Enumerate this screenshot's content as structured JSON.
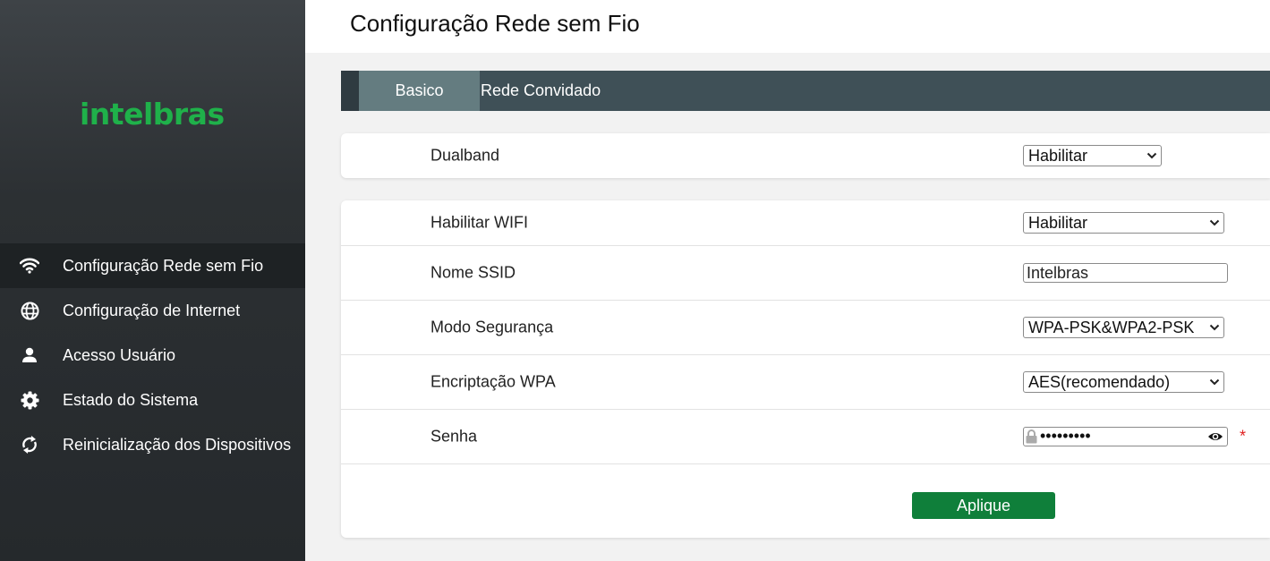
{
  "sidebar": {
    "logo": "intelbras",
    "items": [
      {
        "label": "Configuração Rede sem Fio",
        "icon": "wifi-icon",
        "active": true
      },
      {
        "label": "Configuração de Internet",
        "icon": "globe-icon",
        "active": false
      },
      {
        "label": "Acesso Usuário",
        "icon": "user-icon",
        "active": false
      },
      {
        "label": "Estado do Sistema",
        "icon": "gear-icon",
        "active": false
      },
      {
        "label": "Reinicialização dos Dispositivos",
        "icon": "refresh-icon",
        "active": false
      }
    ]
  },
  "header": {
    "title": "Configuração Rede sem Fio"
  },
  "tabs": [
    {
      "label": "Basico",
      "active": true
    },
    {
      "label": "Rede Convidado",
      "active": false
    }
  ],
  "dualband": {
    "label": "Dualband",
    "value": "Habilitar"
  },
  "form": {
    "wifi": {
      "label": "Habilitar WIFI",
      "value": "Habilitar"
    },
    "ssid": {
      "label": "Nome SSID",
      "value": "Intelbras"
    },
    "security": {
      "label": "Modo Segurança",
      "value": "WPA-PSK&WPA2-PSK"
    },
    "encryption": {
      "label": "Encriptação WPA",
      "value": "AES(recomendado)"
    },
    "password": {
      "label": "Senha",
      "masked": "•••••••••",
      "required_mark": "*"
    }
  },
  "apply_label": "Aplique",
  "colors": {
    "brand": "#1fb14a",
    "apply": "#0f7f3a",
    "tabbar": "#3f5057",
    "tab_active": "#647c80",
    "required": "#e02020"
  }
}
